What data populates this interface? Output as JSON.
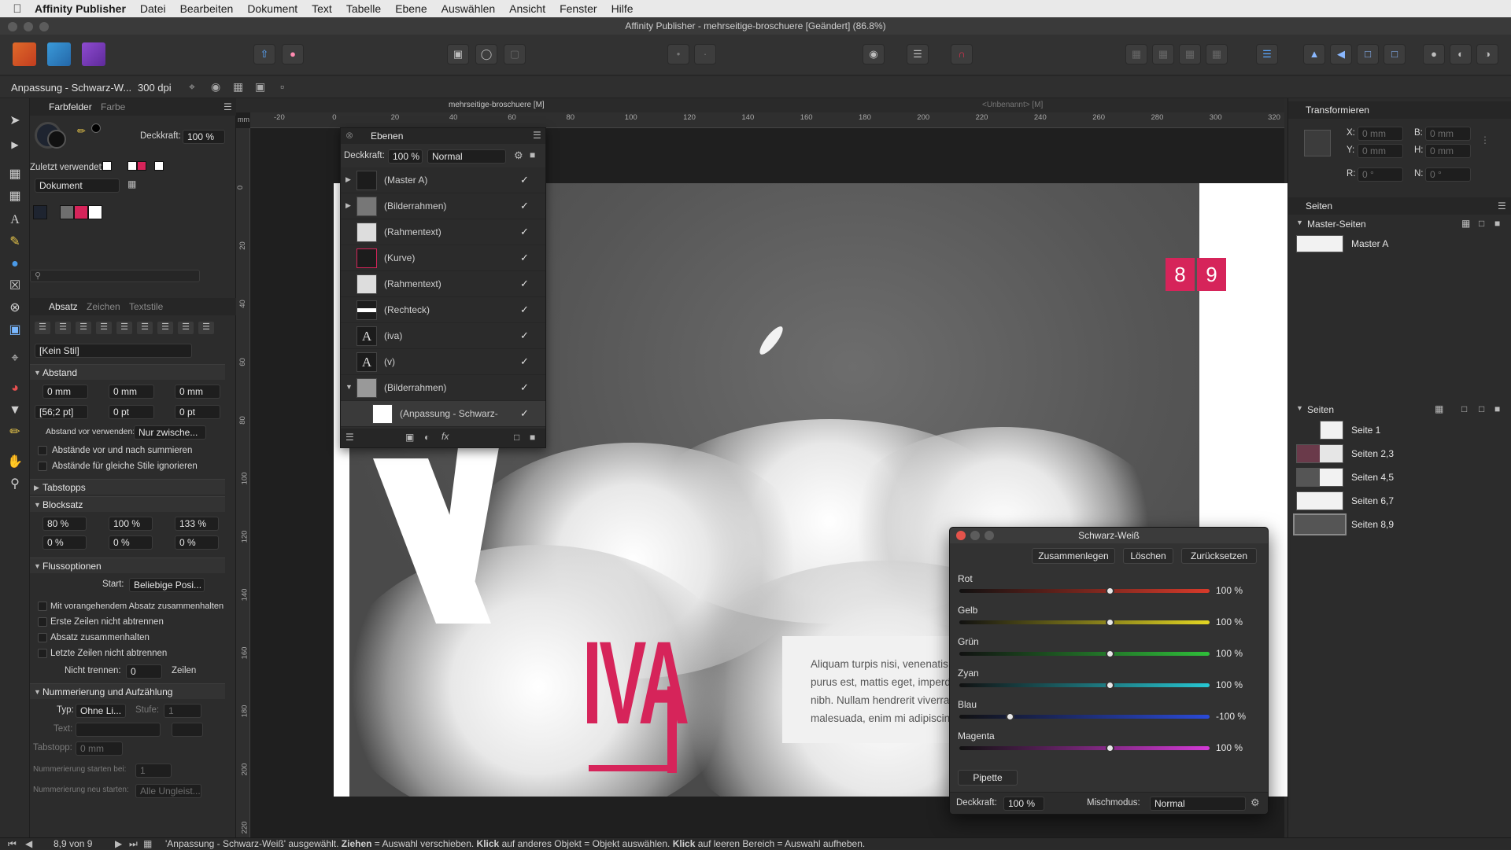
{
  "menubar": {
    "app_name": "Affinity Publisher",
    "items": [
      "Datei",
      "Bearbeiten",
      "Dokument",
      "Text",
      "Tabelle",
      "Ebene",
      "Auswählen",
      "Ansicht",
      "Fenster",
      "Hilfe"
    ]
  },
  "window": {
    "title": "Affinity Publisher - mehrseitige-broschuere [Geändert] (86.8%)"
  },
  "context_toolbar": {
    "name": "Anpassung - Schwarz-W...",
    "dpi": "300 dpi"
  },
  "doc_tabs": {
    "active": "mehrseitige-broschuere [M]",
    "other": "<Unbenannt> [M]"
  },
  "swatches_panel": {
    "tabs": [
      "Farbfelder",
      "Farbe"
    ],
    "opacity_label": "Deckkraft:",
    "opacity_value": "100 %",
    "recent_label": "Zuletzt verwendet:",
    "palette_select": "Dokument",
    "colors": {
      "accent": "#d6245a",
      "white": "#ffffff",
      "dark": "#1e2430",
      "gray": "#6e6e6e"
    }
  },
  "paragraph_panel": {
    "tabs": [
      "Absatz",
      "Zeichen",
      "Textstile"
    ],
    "style_select": "[Kein Stil]",
    "sections": {
      "abstand": "Abstand",
      "tabstopps": "Tabstopps",
      "blocksatz": "Blocksatz",
      "flussoptionen": "Flussoptionen",
      "nummerierung": "Nummerierung und Aufzählung"
    },
    "abstand": {
      "left": "0 mm",
      "right": "0 mm",
      "indent": "0 mm",
      "leading": "[56;2 pt]",
      "before": "0 pt",
      "after": "0 pt",
      "use_label": "Abstand vor verwenden:",
      "use_value": "Nur zwische...",
      "opt1": "Abstände vor und nach summieren",
      "opt2": "Abstände für gleiche Stile ignorieren"
    },
    "blocksatz": {
      "v1": "80 %",
      "v2": "100 %",
      "v3": "133 %",
      "v4": "0 %",
      "v5": "0 %",
      "v6": "0 %"
    },
    "fluss": {
      "start_label": "Start:",
      "start_value": "Beliebige Posi...",
      "opt1": "Mit vorangehendem Absatz zusammenhalten",
      "opt2": "Erste Zeilen nicht abtrennen",
      "opt3": "Absatz zusammenhalten",
      "opt4": "Letzte Zeilen nicht abtrennen",
      "nicht_label": "Nicht trennen:",
      "nicht_value": "0",
      "zeilen": "Zeilen"
    },
    "nummer": {
      "typ_label": "Typ:",
      "typ_value": "Ohne Li...",
      "stufe_label": "Stufe:",
      "stufe_value": "1",
      "text_label": "Text:",
      "tab_label": "Tabstopp:",
      "tab_value": "0 mm",
      "start_label": "Nummerierung starten bei:",
      "start_value": "1",
      "restart_label": "Nummerierung neu starten:",
      "restart_value": "Alle Ungleist..."
    }
  },
  "layers_panel": {
    "title": "Ebenen",
    "opacity_label": "Deckkraft:",
    "opacity_value": "100 %",
    "blend": "Normal",
    "rows": [
      {
        "name": "(Master A)"
      },
      {
        "name": "(Bilderrahmen)"
      },
      {
        "name": "(Rahmentext)"
      },
      {
        "name": "(Kurve)"
      },
      {
        "name": "(Rahmentext)"
      },
      {
        "name": "(Rechteck)"
      },
      {
        "name": "(iva)"
      },
      {
        "name": "(v)"
      },
      {
        "name": "(Bilderrahmen)"
      },
      {
        "name": "(Anpassung - Schwarz-"
      }
    ]
  },
  "ruler": {
    "h": [
      "-20",
      "0",
      "20",
      "40",
      "60",
      "80",
      "100",
      "120",
      "140",
      "160",
      "180",
      "200",
      "220",
      "240",
      "260",
      "280",
      "300",
      "320"
    ],
    "v": [
      "0",
      "20",
      "40",
      "60",
      "80",
      "100",
      "120",
      "140",
      "160",
      "180",
      "200",
      "220"
    ],
    "unit": "mm"
  },
  "page": {
    "page_numbers": [
      "8",
      "9"
    ],
    "headline": "IVA",
    "body_lines": [
      "Aliquam turpis nisi, venenatis",
      "purus est, mattis eget, imperd",
      "nibh. Nullam hendrerit viverra",
      "malesuada, enim mi adipiscin"
    ]
  },
  "transform_panel": {
    "title": "Transformieren",
    "x_label": "X:",
    "x_value": "0 mm",
    "y_label": "Y:",
    "y_value": "0 mm",
    "b_label": "B:",
    "b_value": "0 mm",
    "h_label": "H:",
    "h_value": "0 mm",
    "r_label": "R:",
    "r_value": "0 °",
    "n_label": "N:",
    "n_value": "0 °"
  },
  "pages_panel": {
    "title": "Seiten",
    "master_header": "Master-Seiten",
    "master_item": "Master A",
    "pages_header": "Seiten",
    "pages": [
      "Seite 1",
      "Seiten 2,3",
      "Seiten 4,5",
      "Seiten 6,7",
      "Seiten 8,9"
    ]
  },
  "bw_dialog": {
    "title": "Schwarz-Weiß",
    "buttons": [
      "Zusammenlegen",
      "Löschen",
      "Zurücksetzen"
    ],
    "sliders": [
      {
        "name": "Rot",
        "value": "100 %",
        "fraction": 0.6,
        "color": "#d83a2a"
      },
      {
        "name": "Gelb",
        "value": "100 %",
        "fraction": 0.6,
        "color": "#e3d623"
      },
      {
        "name": "Grün",
        "value": "100 %",
        "fraction": 0.6,
        "color": "#2fbf3a"
      },
      {
        "name": "Zyan",
        "value": "100 %",
        "fraction": 0.6,
        "color": "#27c7d3"
      },
      {
        "name": "Blau",
        "value": "-100 %",
        "fraction": 0.2,
        "color": "#2a4ad8"
      },
      {
        "name": "Magenta",
        "value": "100 %",
        "fraction": 0.6,
        "color": "#d33ad6"
      }
    ],
    "pipette": "Pipette",
    "opacity_label": "Deckkraft:",
    "opacity_value": "100 %",
    "blend_label": "Mischmodus:",
    "blend_value": "Normal"
  },
  "status": {
    "page": "8,9 von 9",
    "msg1": "'Anpassung - Schwarz-Weiß' ausgewählt. ",
    "k1": "Ziehen",
    "msg2": " = Auswahl verschieben. ",
    "k2": "Klick",
    "msg3": " auf anderes Objekt = Objekt auswählen. ",
    "k3": "Klick",
    "msg4": " auf leeren Bereich = Auswahl aufheben."
  }
}
